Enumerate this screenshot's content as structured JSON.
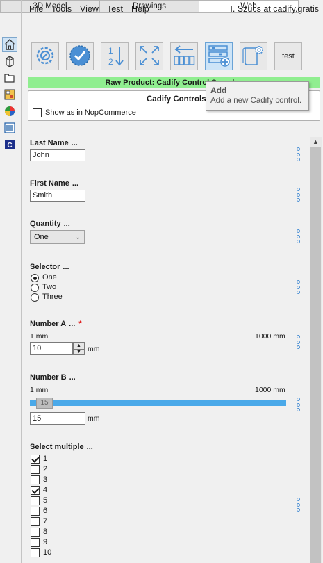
{
  "menu": {
    "items": [
      "File",
      "Tools",
      "View",
      "Test",
      "Help"
    ],
    "user": "I. Szücs at cadify.gratis"
  },
  "tabs": [
    {
      "label": "3D Model",
      "active": false
    },
    {
      "label": "Drawings",
      "active": false
    },
    {
      "label": "Web",
      "active": true
    }
  ],
  "left_icons": [
    "home-icon",
    "parts-icon",
    "folder-icon",
    "layout-icon",
    "color-wheel-icon",
    "list-icon",
    "cadify-icon"
  ],
  "toolbar": {
    "icons": [
      "settings-icon",
      "validate-icon",
      "sort-order-icon",
      "expand-icon",
      "arrange-icon",
      "add-control-icon",
      "document-settings-icon"
    ],
    "test_label": "test"
  },
  "raw_product": "Raw Product: Cadify Control Samples",
  "tooltip": {
    "title": "Add",
    "description": "Add a new Cadify control."
  },
  "controls_box": {
    "title": "Cadify Controls",
    "show_nop_label": "Show as in NopCommerce"
  },
  "fields": {
    "last_name": {
      "label": "Last Name",
      "ellipsis": "...",
      "value": "John"
    },
    "first_name": {
      "label": "First Name",
      "ellipsis": "...",
      "value": "Smith"
    },
    "quantity": {
      "label": "Quantity",
      "ellipsis": "...",
      "value": "One"
    },
    "selector": {
      "label": "Selector",
      "ellipsis": "...",
      "options": [
        "One",
        "Two",
        "Three"
      ],
      "selected": "One"
    },
    "number_a": {
      "label": "Number A",
      "ellipsis": "...",
      "required_mark": "*",
      "min_label": "1 mm",
      "max_label": "1000 mm",
      "value": "10",
      "unit": "mm"
    },
    "number_b": {
      "label": "Number B",
      "ellipsis": "...",
      "min_label": "1 mm",
      "max_label": "1000 mm",
      "slider_value": "15",
      "value": "15",
      "unit": "mm"
    },
    "select_multiple": {
      "label": "Select multiple",
      "ellipsis": "...",
      "options": [
        "1",
        "2",
        "3",
        "4",
        "5",
        "6",
        "7",
        "8",
        "9",
        "10"
      ],
      "checked": [
        "1",
        "4"
      ]
    }
  },
  "colors": {
    "raw_bar": "#90ee90",
    "slider": "#4aa9e9",
    "selected_button": "#cde4f7",
    "required": "#e02020"
  }
}
